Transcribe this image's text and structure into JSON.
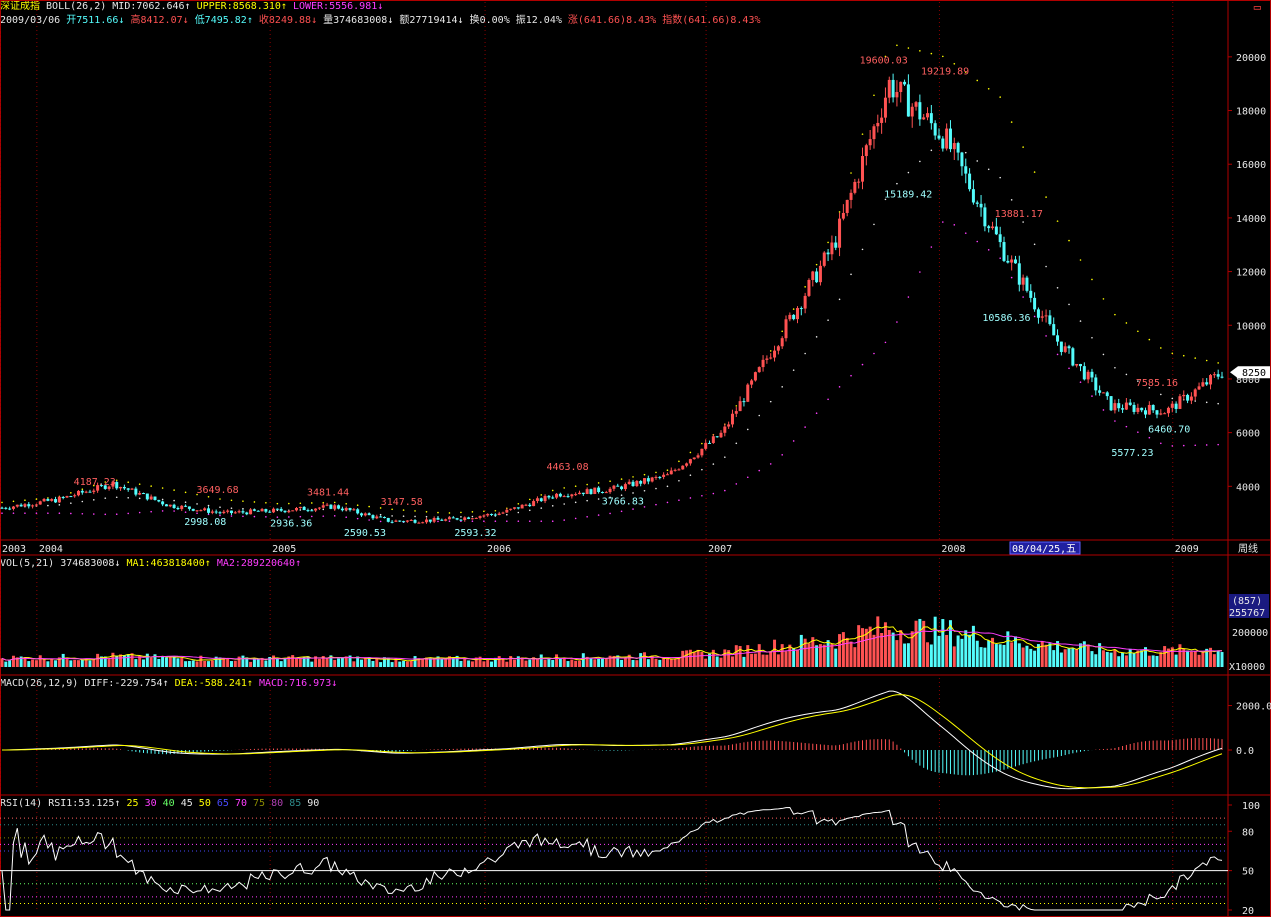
{
  "header": {
    "index_name": "深证成指",
    "boll_label": "BOLL(26,2)",
    "mid": "MID:7062.646",
    "upper": "UPPER:8568.310",
    "lower": "LOWER:5556.981",
    "date": "2009/03/06",
    "open": "开7511.66",
    "high": "高8412.07",
    "low": "低7495.82",
    "close": "收8249.88",
    "volume": "量374683008",
    "amount": "额27719414",
    "turnover": "换0.00%",
    "amplitude": "振12.04%",
    "change": "涨(641.66)8.43%",
    "index_change": "指数(641.66)8.43%"
  },
  "price_panel": {
    "y_ticks": [
      "20000",
      "18000",
      "16000",
      "14000",
      "12000",
      "10000",
      "8000",
      "6000",
      "4000"
    ],
    "current_tag": "8250",
    "annotations": [
      {
        "text": "4187.23",
        "type": "high"
      },
      {
        "text": "2998.08",
        "type": "low"
      },
      {
        "text": "3649.68",
        "type": "high"
      },
      {
        "text": "2936.36",
        "type": "low"
      },
      {
        "text": "3481.44",
        "type": "high"
      },
      {
        "text": "2590.53",
        "type": "low"
      },
      {
        "text": "3147.58",
        "type": "high"
      },
      {
        "text": "2593.32",
        "type": "low"
      },
      {
        "text": "4463.08",
        "type": "high"
      },
      {
        "text": "3766.83",
        "type": "low"
      },
      {
        "text": "19600.03",
        "type": "high"
      },
      {
        "text": "19219.89",
        "type": "high"
      },
      {
        "text": "15189.42",
        "type": "low"
      },
      {
        "text": "13881.17",
        "type": "high"
      },
      {
        "text": "10586.36",
        "type": "low"
      },
      {
        "text": "7585.16",
        "type": "high"
      },
      {
        "text": "6460.70",
        "type": "low"
      },
      {
        "text": "5577.23",
        "type": "low"
      }
    ],
    "x_labels": [
      "2003",
      "2004",
      "2005",
      "2006",
      "2007",
      "2008",
      "2009"
    ],
    "cursor_label": "08/04/25,五",
    "period_label": "周线"
  },
  "volume_panel": {
    "legend": [
      "VOL(5,21)",
      "374683008",
      "MA1:463818400",
      "MA2:289220640"
    ],
    "y_ticks": [
      "(857)",
      "255767",
      "200000",
      "X10000"
    ]
  },
  "macd_panel": {
    "legend": [
      "MACD(26,12,9)",
      "DIFF:-229.754",
      "DEA:-588.241",
      "MACD:716.973"
    ],
    "y_ticks": [
      "2000.0",
      "0.0"
    ]
  },
  "rsi_panel": {
    "legend": [
      "RSI(14)",
      "RSI1:53.125",
      "25",
      "30",
      "40",
      "45",
      "50",
      "65",
      "70",
      "75",
      "80",
      "85",
      "90"
    ],
    "y_ticks": [
      "100",
      "80",
      "50",
      "20"
    ]
  },
  "colors": {
    "up": "#ff5252",
    "down": "#54fcfc",
    "mid": "#e8e8e8",
    "upper": "#ffff00",
    "lower": "#ff3dff",
    "grid": "#8b0000"
  },
  "chart_data": {
    "type": "candlestick",
    "period": "weekly",
    "x": [
      "2003-09",
      "2004-01",
      "2004-04",
      "2004-07",
      "2004-10",
      "2005-01",
      "2005-04",
      "2005-07",
      "2005-10",
      "2006-01",
      "2006-04",
      "2006-07",
      "2006-10",
      "2007-01",
      "2007-04",
      "2007-07",
      "2007-10",
      "2008-01",
      "2008-04",
      "2008-07",
      "2008-10",
      "2009-01",
      "2009-03"
    ],
    "close": [
      3200,
      3500,
      4100,
      3300,
      3000,
      3100,
      3250,
      2700,
      2750,
      3000,
      3700,
      3900,
      4400,
      6000,
      9500,
      13000,
      19000,
      17000,
      13000,
      9500,
      7000,
      6800,
      8250
    ],
    "boll_mid": [
      3200,
      3300,
      3600,
      3500,
      3200,
      3100,
      3150,
      2900,
      2850,
      2900,
      3300,
      3600,
      4000,
      5000,
      7500,
      10500,
      15000,
      17000,
      15500,
      11500,
      8500,
      7300,
      7063
    ],
    "boll_upper": [
      3400,
      3600,
      4250,
      3900,
      3500,
      3350,
      3400,
      3150,
      3000,
      3100,
      3900,
      4200,
      4600,
      6200,
      9500,
      13500,
      20500,
      20000,
      18500,
      14000,
      10500,
      9000,
      8568
    ],
    "boll_lower": [
      3000,
      3000,
      2950,
      3100,
      2900,
      2850,
      2900,
      2650,
      2700,
      2700,
      2700,
      3000,
      3400,
      3800,
      5000,
      7500,
      9500,
      14000,
      12500,
      9000,
      6500,
      5500,
      5557
    ],
    "ylim": [
      2000,
      21000
    ],
    "volume_ylim": [
      0,
      300000
    ],
    "macd": {
      "diff": -229.754,
      "dea": -588.241,
      "macd": 716.973,
      "ylim": [
        -1800,
        2700
      ]
    },
    "rsi": {
      "rsi1": 53.125,
      "ylim": [
        20,
        100
      ]
    }
  }
}
